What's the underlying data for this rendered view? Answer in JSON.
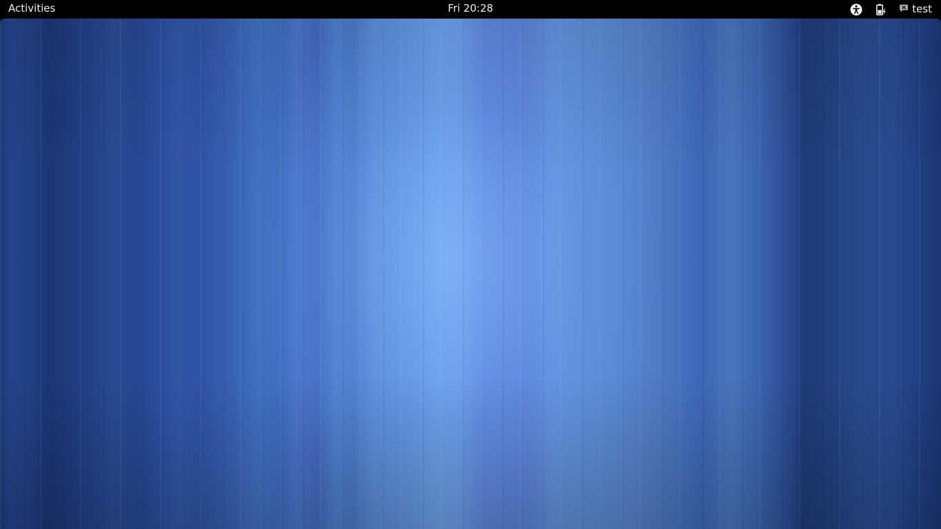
{
  "top_bar": {
    "activities_label": "Activities",
    "clock_text": "Fri 20:28",
    "user_name": "test",
    "icons": {
      "accessibility": "accessibility-icon",
      "battery": "battery-charging-icon",
      "chat_status": "chat-status-icon"
    }
  },
  "desktop": {
    "wallpaper": "blue vertical stripes",
    "colors": {
      "panel_bg": "#000000",
      "panel_text": "#f2f2f2",
      "wallpaper_dark": "#1f3a78",
      "wallpaper_light": "#6b9be6"
    }
  }
}
